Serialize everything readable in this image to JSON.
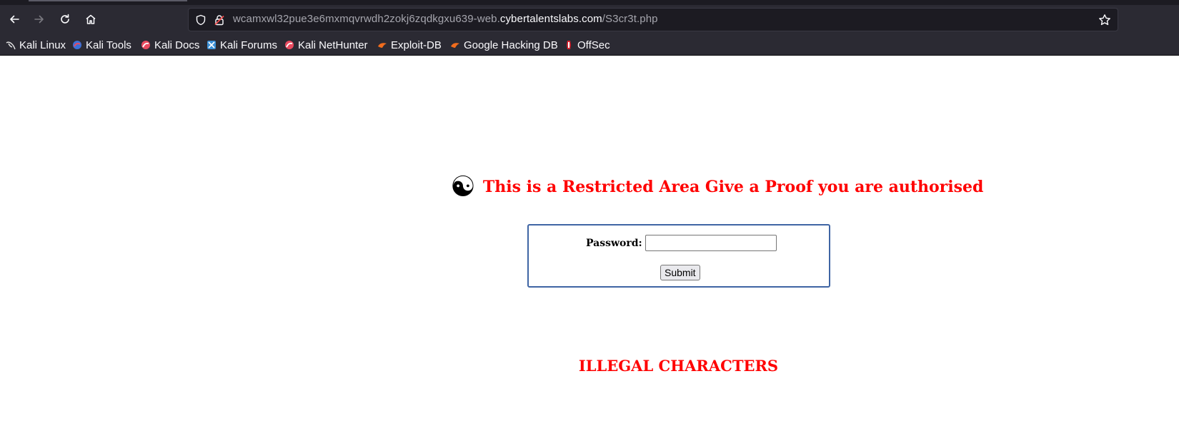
{
  "browser": {
    "url": {
      "prefix": "wcamxwl32pue3e6mxmqvrwdh2zokj6zqdkgxu639-web.",
      "domain": "cybertalentslabs.com",
      "path": "/S3cr3t.php"
    },
    "bookmarks": [
      {
        "label": "Kali Linux",
        "icon": "kali-dragon-icon"
      },
      {
        "label": "Kali Tools",
        "icon": "kali-tools-icon"
      },
      {
        "label": "Kali Docs",
        "icon": "kali-docs-icon"
      },
      {
        "label": "Kali Forums",
        "icon": "kali-forums-icon"
      },
      {
        "label": "Kali NetHunter",
        "icon": "kali-nethunter-icon"
      },
      {
        "label": "Exploit-DB",
        "icon": "exploit-db-icon"
      },
      {
        "label": "Google Hacking DB",
        "icon": "google-hacking-db-icon"
      },
      {
        "label": "OffSec",
        "icon": "offsec-icon"
      }
    ]
  },
  "page": {
    "symbol": "☯",
    "heading": "This is a Restricted Area Give a Proof you are authorised",
    "password_label": "Password:",
    "password_value": "",
    "submit_label": "Submit",
    "message": "ILLEGAL CHARACTERS"
  },
  "colors": {
    "heading": "#ff0000",
    "form_border": "#3f65a4",
    "chrome_bg": "#2b2a33"
  }
}
